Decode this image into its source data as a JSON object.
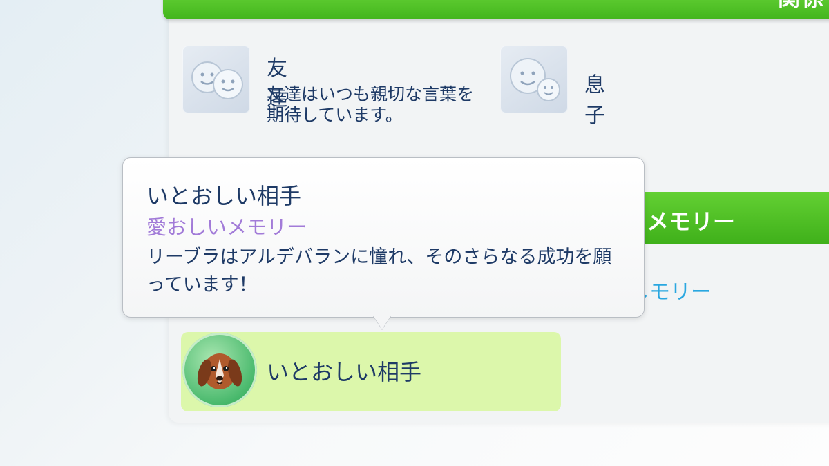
{
  "header": {
    "title": "関係"
  },
  "relationships": [
    {
      "title": "友達",
      "description": "友達はいつも親切な言葉を期待しています。",
      "icon": "friends-faces-icon"
    },
    {
      "title": "息子",
      "icon": "parent-child-faces-icon"
    }
  ],
  "memory_section": {
    "title": "メモリー",
    "link_text": "メモリー"
  },
  "trait": {
    "label": "いとおしい相手",
    "icon": "dog-avatar-icon"
  },
  "tooltip": {
    "title": "いとおしい相手",
    "subtitle": "愛おしいメモリー",
    "description": "リーブラはアルデバランに憧れ、そのさらなる成功を願っています！"
  },
  "colors": {
    "accent_green": "#43b51d",
    "text_navy": "#1e3a66",
    "subtitle_purple": "#a27bd8",
    "link_blue": "#2aa7e0",
    "trait_bg": "#dcf7ab"
  }
}
